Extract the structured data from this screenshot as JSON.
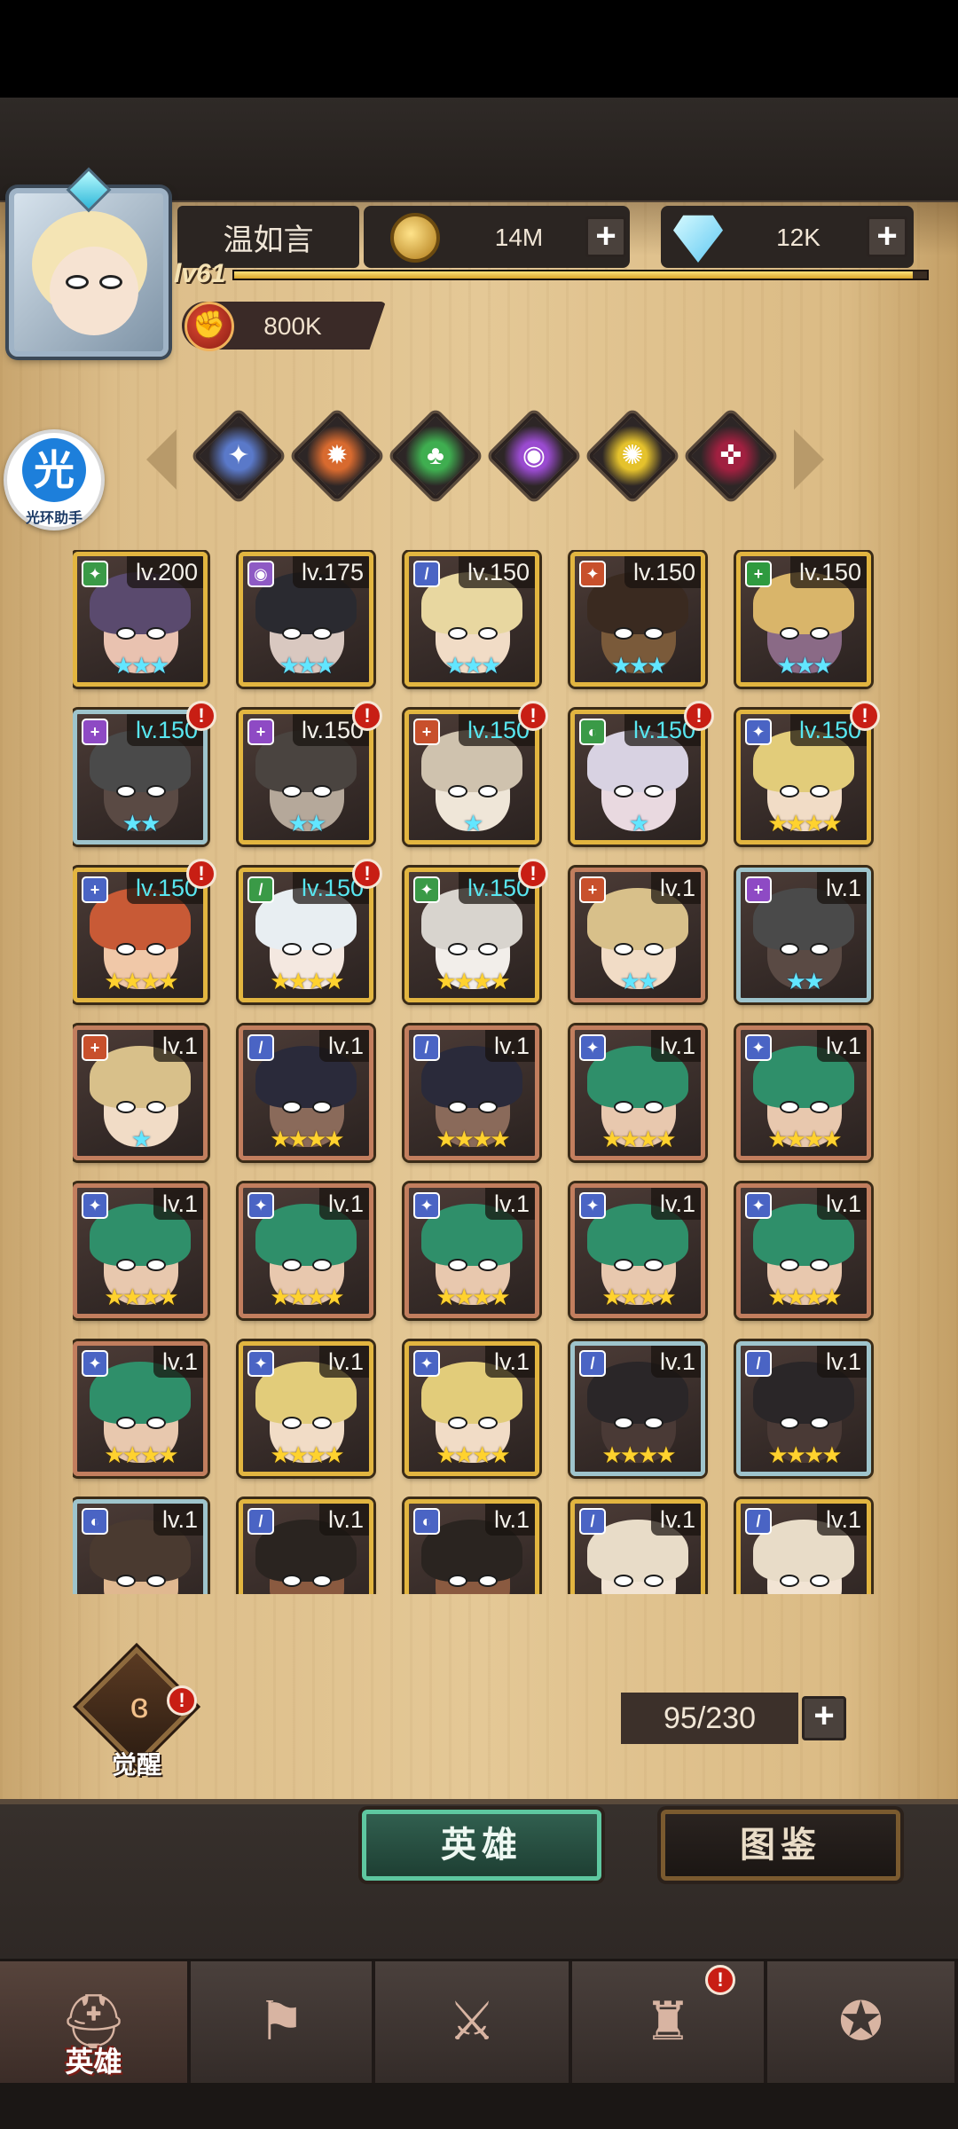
{
  "player": {
    "name": "温如言",
    "level_label": "lv61",
    "xp_fraction": 0.98,
    "power": "800K"
  },
  "currencies": {
    "gold": {
      "icon": "gold-coin-icon",
      "value": "14M",
      "plus": "+"
    },
    "diamond": {
      "icon": "diamond-icon",
      "value": "12K",
      "plus": "+"
    }
  },
  "helper": {
    "icon_text": "光",
    "label": "光环助手"
  },
  "filters": [
    {
      "icon": "class-filter-1-icon",
      "glyph": "✦",
      "color": "#5a79c9"
    },
    {
      "icon": "class-filter-2-icon",
      "glyph": "✹",
      "color": "#d86a2f"
    },
    {
      "icon": "class-filter-3-icon",
      "glyph": "♣",
      "color": "#3fae50"
    },
    {
      "icon": "class-filter-4-icon",
      "glyph": "◉",
      "color": "#9a4bd0"
    },
    {
      "icon": "class-filter-5-icon",
      "glyph": "✺",
      "color": "#e5c22c"
    },
    {
      "icon": "class-filter-6-icon",
      "glyph": "✜",
      "color": "#a02040"
    }
  ],
  "heroes": [
    {
      "level": "lv.200",
      "rarity": "gold",
      "stars": 3,
      "star_color": "blue",
      "cyan": false,
      "alert": false,
      "class_color": "#3a9a47",
      "class_glyph": "✦",
      "hair": "#5a4a6e",
      "skin": "#e9c2b0"
    },
    {
      "level": "lv.175",
      "rarity": "gold",
      "stars": 3,
      "star_color": "blue",
      "cyan": false,
      "alert": false,
      "class_color": "#8e5ac4",
      "class_glyph": "◉",
      "hair": "#2a2a30",
      "skin": "#d9c8c0"
    },
    {
      "level": "lv.150",
      "rarity": "gold",
      "stars": 3,
      "star_color": "blue",
      "cyan": false,
      "alert": false,
      "class_color": "#4a64c4",
      "class_glyph": "/",
      "hair": "#e8d7a0",
      "skin": "#f1dcc6"
    },
    {
      "level": "lv.150",
      "rarity": "gold",
      "stars": 3,
      "star_color": "blue",
      "cyan": false,
      "alert": false,
      "class_color": "#c8502c",
      "class_glyph": "✦",
      "hair": "#3a2a20",
      "skin": "#7a5a3a"
    },
    {
      "level": "lv.150",
      "rarity": "gold",
      "stars": 3,
      "star_color": "blue",
      "cyan": false,
      "alert": false,
      "class_color": "#2f9a3f",
      "class_glyph": "+",
      "hair": "#d9b56a",
      "skin": "#8a6a86"
    },
    {
      "level": "lv.150",
      "rarity": "silver",
      "stars": 2,
      "star_color": "blue",
      "cyan": true,
      "alert": true,
      "class_color": "#8e4ac4",
      "class_glyph": "+",
      "hair": "#4a4a4a",
      "skin": "#5a4a44"
    },
    {
      "level": "lv.150",
      "rarity": "gold",
      "stars": 2,
      "star_color": "blue",
      "cyan": false,
      "alert": true,
      "class_color": "#8e4ac4",
      "class_glyph": "+",
      "hair": "#4a4440",
      "skin": "#b5a89a"
    },
    {
      "level": "lv.150",
      "rarity": "gold",
      "stars": 1,
      "star_color": "blue",
      "cyan": true,
      "alert": true,
      "class_color": "#c8502c",
      "class_glyph": "+",
      "hair": "#cfc2ae",
      "skin": "#efe6d8"
    },
    {
      "level": "lv.150",
      "rarity": "gold",
      "stars": 1,
      "star_color": "blue",
      "cyan": true,
      "alert": true,
      "class_color": "#3a9a47",
      "class_glyph": "◐",
      "hair": "#d8d2e2",
      "skin": "#e9d9e0"
    },
    {
      "level": "lv.150",
      "rarity": "gold",
      "stars": 4,
      "star_color": "yellow",
      "cyan": true,
      "alert": true,
      "class_color": "#4a64c4",
      "class_glyph": "✦",
      "hair": "#e2cc7a",
      "skin": "#f1dcc6"
    },
    {
      "level": "lv.150",
      "rarity": "gold",
      "stars": 4,
      "star_color": "yellow",
      "cyan": true,
      "alert": true,
      "class_color": "#4a64c4",
      "class_glyph": "+",
      "hair": "#c85a36",
      "skin": "#f0c8a8"
    },
    {
      "level": "lv.150",
      "rarity": "gold",
      "stars": 4,
      "star_color": "yellow",
      "cyan": true,
      "alert": true,
      "class_color": "#3a9a47",
      "class_glyph": "/",
      "hair": "#e8eef2",
      "skin": "#f4e8e0"
    },
    {
      "level": "lv.150",
      "rarity": "gold",
      "stars": 4,
      "star_color": "yellow",
      "cyan": true,
      "alert": true,
      "class_color": "#3a9a47",
      "class_glyph": "✦",
      "hair": "#d8d4ce",
      "skin": "#f2eeea"
    },
    {
      "level": "lv.1",
      "rarity": "copper",
      "stars": 2,
      "star_color": "blue",
      "cyan": false,
      "alert": false,
      "class_color": "#c8502c",
      "class_glyph": "+",
      "hair": "#d8c08a",
      "skin": "#f1dcc6"
    },
    {
      "level": "lv.1",
      "rarity": "silver",
      "stars": 2,
      "star_color": "blue",
      "cyan": false,
      "alert": false,
      "class_color": "#8e4ac4",
      "class_glyph": "+",
      "hair": "#4a4a4a",
      "skin": "#5a4a44"
    },
    {
      "level": "lv.1",
      "rarity": "copper",
      "stars": 1,
      "star_color": "blue",
      "cyan": false,
      "alert": false,
      "class_color": "#c8502c",
      "class_glyph": "+",
      "hair": "#d8c08a",
      "skin": "#f1dcc6"
    },
    {
      "level": "lv.1",
      "rarity": "copper",
      "stars": 4,
      "star_color": "yellow",
      "cyan": false,
      "alert": false,
      "class_color": "#4a64c4",
      "class_glyph": "/",
      "hair": "#2a2a3a",
      "skin": "#8a6a5a"
    },
    {
      "level": "lv.1",
      "rarity": "copper",
      "stars": 4,
      "star_color": "yellow",
      "cyan": false,
      "alert": false,
      "class_color": "#4a64c4",
      "class_glyph": "/",
      "hair": "#2a2a3a",
      "skin": "#8a6a5a"
    },
    {
      "level": "lv.1",
      "rarity": "copper",
      "stars": 4,
      "star_color": "yellow",
      "cyan": false,
      "alert": false,
      "class_color": "#4a64c4",
      "class_glyph": "✦",
      "hair": "#2f8f6a",
      "skin": "#e8c8ae"
    },
    {
      "level": "lv.1",
      "rarity": "copper",
      "stars": 4,
      "star_color": "yellow",
      "cyan": false,
      "alert": false,
      "class_color": "#4a64c4",
      "class_glyph": "✦",
      "hair": "#2f8f6a",
      "skin": "#e8c8ae"
    },
    {
      "level": "lv.1",
      "rarity": "copper",
      "stars": 4,
      "star_color": "yellow",
      "cyan": false,
      "alert": false,
      "class_color": "#4a64c4",
      "class_glyph": "✦",
      "hair": "#2f8f6a",
      "skin": "#e8c8ae"
    },
    {
      "level": "lv.1",
      "rarity": "copper",
      "stars": 4,
      "star_color": "yellow",
      "cyan": false,
      "alert": false,
      "class_color": "#4a64c4",
      "class_glyph": "✦",
      "hair": "#2f8f6a",
      "skin": "#e8c8ae"
    },
    {
      "level": "lv.1",
      "rarity": "copper",
      "stars": 4,
      "star_color": "yellow",
      "cyan": false,
      "alert": false,
      "class_color": "#4a64c4",
      "class_glyph": "✦",
      "hair": "#2f8f6a",
      "skin": "#e8c8ae"
    },
    {
      "level": "lv.1",
      "rarity": "copper",
      "stars": 4,
      "star_color": "yellow",
      "cyan": false,
      "alert": false,
      "class_color": "#4a64c4",
      "class_glyph": "✦",
      "hair": "#2f8f6a",
      "skin": "#e8c8ae"
    },
    {
      "level": "lv.1",
      "rarity": "copper",
      "stars": 4,
      "star_color": "yellow",
      "cyan": false,
      "alert": false,
      "class_color": "#4a64c4",
      "class_glyph": "✦",
      "hair": "#2f8f6a",
      "skin": "#e8c8ae"
    },
    {
      "level": "lv.1",
      "rarity": "copper",
      "stars": 4,
      "star_color": "yellow",
      "cyan": false,
      "alert": false,
      "class_color": "#4a64c4",
      "class_glyph": "✦",
      "hair": "#2f8f6a",
      "skin": "#e8c8ae"
    },
    {
      "level": "lv.1",
      "rarity": "gold",
      "stars": 4,
      "star_color": "yellow",
      "cyan": false,
      "alert": false,
      "class_color": "#4a64c4",
      "class_glyph": "✦",
      "hair": "#e2cc7a",
      "skin": "#f1dcc6"
    },
    {
      "level": "lv.1",
      "rarity": "gold",
      "stars": 4,
      "star_color": "yellow",
      "cyan": false,
      "alert": false,
      "class_color": "#4a64c4",
      "class_glyph": "✦",
      "hair": "#e2cc7a",
      "skin": "#f1dcc6"
    },
    {
      "level": "lv.1",
      "rarity": "silver",
      "stars": 4,
      "star_color": "yellow",
      "cyan": false,
      "alert": false,
      "class_color": "#4a64c4",
      "class_glyph": "/",
      "hair": "#2a2628",
      "skin": "#4a3a36"
    },
    {
      "level": "lv.1",
      "rarity": "silver",
      "stars": 4,
      "star_color": "yellow",
      "cyan": false,
      "alert": false,
      "class_color": "#4a64c4",
      "class_glyph": "/",
      "hair": "#2a2628",
      "skin": "#4a3a36"
    },
    {
      "level": "lv.1",
      "rarity": "silver",
      "stars": 0,
      "star_color": "yellow",
      "cyan": false,
      "alert": false,
      "class_color": "#4a64c4",
      "class_glyph": "◐",
      "hair": "#4a3a30",
      "skin": "#e0b890"
    },
    {
      "level": "lv.1",
      "rarity": "gold",
      "stars": 0,
      "star_color": "yellow",
      "cyan": false,
      "alert": false,
      "class_color": "#4a64c4",
      "class_glyph": "/",
      "hair": "#2a2420",
      "skin": "#8a5a40"
    },
    {
      "level": "lv.1",
      "rarity": "gold",
      "stars": 0,
      "star_color": "yellow",
      "cyan": false,
      "alert": false,
      "class_color": "#4a64c4",
      "class_glyph": "◐",
      "hair": "#2a2420",
      "skin": "#8a5a40"
    },
    {
      "level": "lv.1",
      "rarity": "gold",
      "stars": 0,
      "star_color": "yellow",
      "cyan": false,
      "alert": false,
      "class_color": "#4a64c4",
      "class_glyph": "/",
      "hair": "#e8dcc8",
      "skin": "#f2e4d4"
    },
    {
      "level": "lv.1",
      "rarity": "gold",
      "stars": 0,
      "star_color": "yellow",
      "cyan": false,
      "alert": false,
      "class_color": "#4a64c4",
      "class_glyph": "/",
      "hair": "#e8dcc8",
      "skin": "#f2e4d4"
    }
  ],
  "awaken": {
    "label": "觉醒",
    "icon": "awaken-icon",
    "alert": "!"
  },
  "capacity": {
    "value": "95/230",
    "plus": "+"
  },
  "tabs": {
    "heroes": "英雄",
    "codex": "图鉴"
  },
  "nav": [
    {
      "icon": "helmet-icon",
      "glyph": "⛑",
      "label": "英雄",
      "active": true,
      "alert": false
    },
    {
      "icon": "banner-icon",
      "glyph": "⚑",
      "label": "",
      "active": false,
      "alert": false
    },
    {
      "icon": "crossed-swords-icon",
      "glyph": "⚔",
      "label": "",
      "active": false,
      "alert": false
    },
    {
      "icon": "castle-icon",
      "glyph": "♜",
      "label": "",
      "active": false,
      "alert": true
    },
    {
      "icon": "handshake-icon",
      "glyph": "✪",
      "label": "",
      "active": false,
      "alert": false
    }
  ],
  "alert_glyph": "!"
}
